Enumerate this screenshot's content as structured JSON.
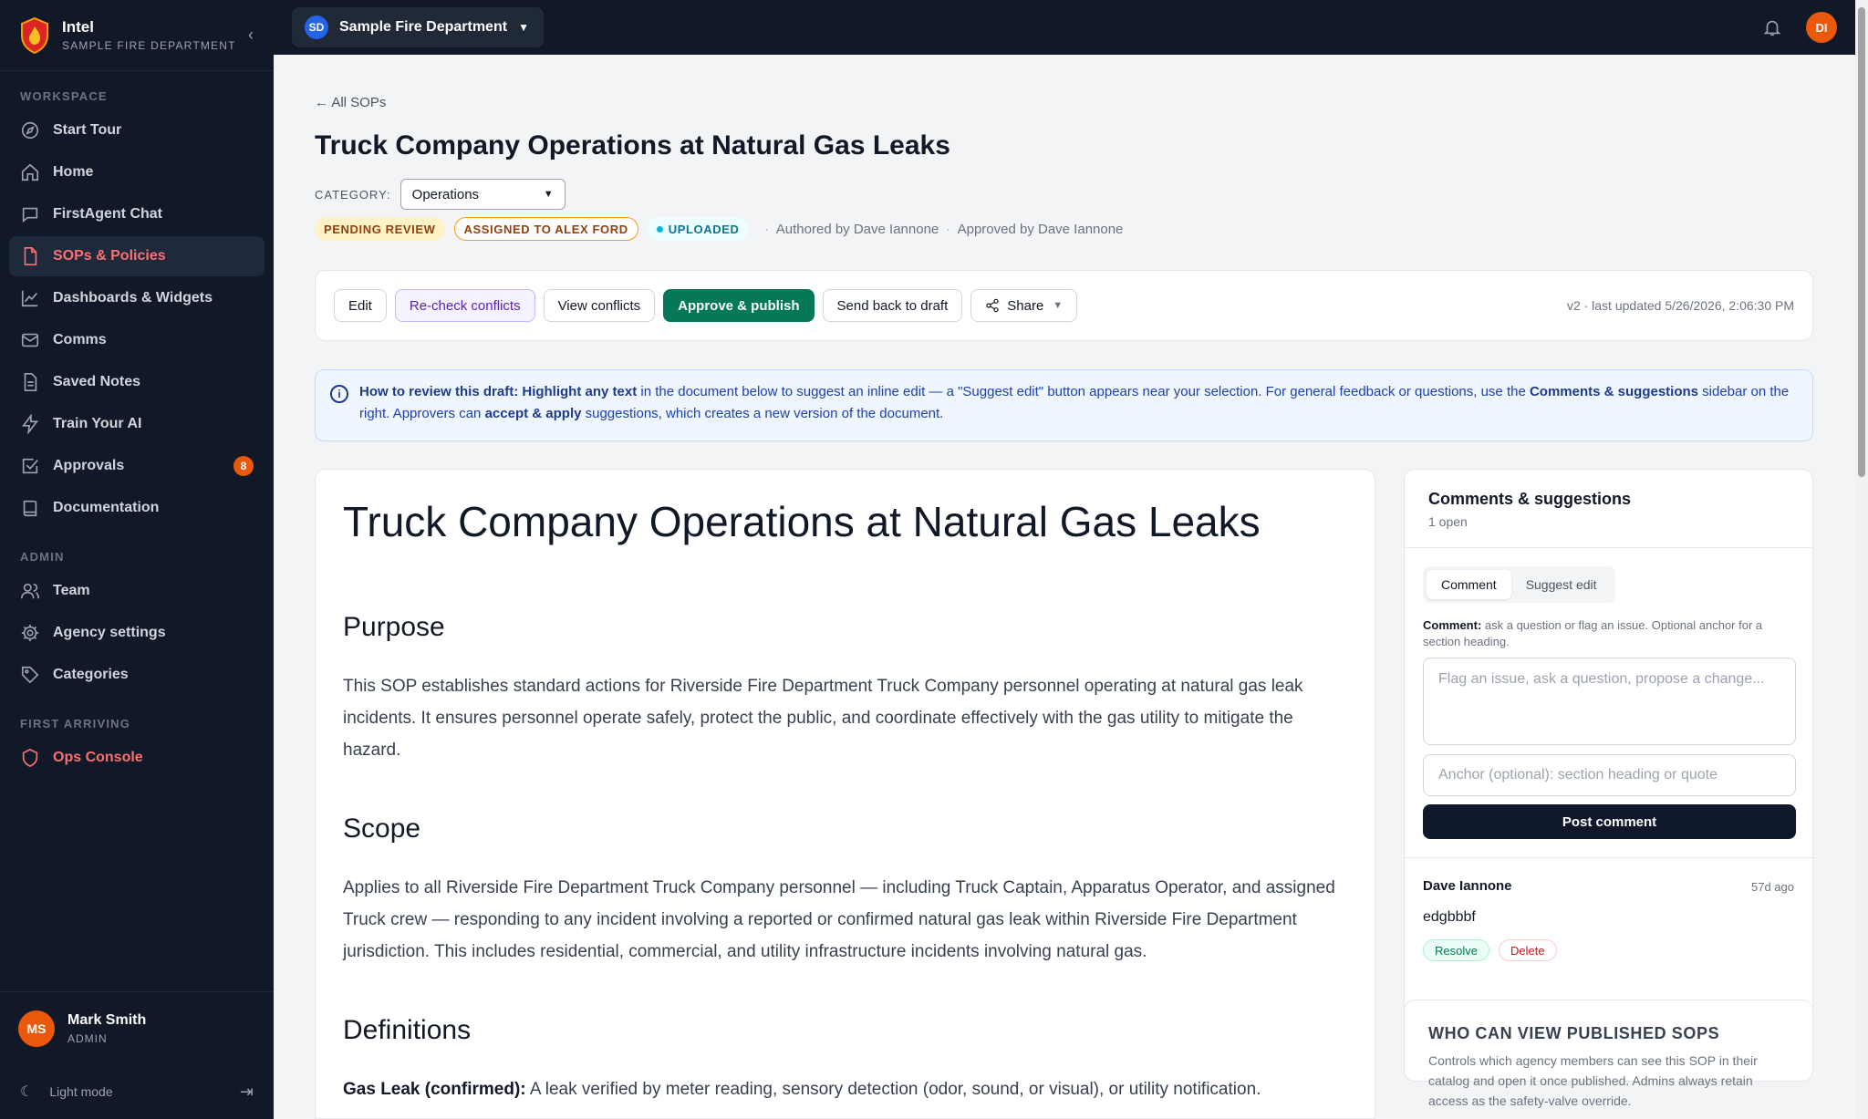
{
  "brand": {
    "name": "Intel",
    "subtitle": "SAMPLE FIRE DEPARTMENT"
  },
  "sidebar": {
    "workspace_label": "WORKSPACE",
    "workspace_items": [
      {
        "label": "Start Tour",
        "icon": "compass-icon"
      },
      {
        "label": "Home",
        "icon": "home-icon"
      },
      {
        "label": "FirstAgent Chat",
        "icon": "chat-icon"
      },
      {
        "label": "SOPs & Policies",
        "icon": "document-icon",
        "active": true
      },
      {
        "label": "Dashboards & Widgets",
        "icon": "chart-icon"
      },
      {
        "label": "Comms",
        "icon": "mail-icon"
      },
      {
        "label": "Saved Notes",
        "icon": "notes-icon"
      },
      {
        "label": "Train Your AI",
        "icon": "bolt-icon"
      },
      {
        "label": "Approvals",
        "icon": "check-square-icon",
        "badge": "8"
      },
      {
        "label": "Documentation",
        "icon": "book-icon"
      }
    ],
    "admin_label": "ADMIN",
    "admin_items": [
      {
        "label": "Team",
        "icon": "users-icon"
      },
      {
        "label": "Agency settings",
        "icon": "gear-icon"
      },
      {
        "label": "Categories",
        "icon": "tag-icon"
      }
    ],
    "first_arriving_label": "FIRST ARRIVING",
    "first_arriving_items": [
      {
        "label": "Ops Console",
        "icon": "shield-icon"
      }
    ],
    "user": {
      "initials": "MS",
      "name": "Mark Smith",
      "role": "ADMIN"
    },
    "mode_label": "Light mode"
  },
  "topbar": {
    "dept_initials": "SD",
    "dept_name": "Sample Fire Department",
    "user_initials": "DI"
  },
  "page": {
    "back_link": "← All SOPs",
    "title": "Truck Company Operations at Natural Gas Leaks",
    "category_label": "CATEGORY:",
    "category_value": "Operations",
    "badges": {
      "pending": "PENDING REVIEW",
      "assigned": "ASSIGNED TO ALEX FORD",
      "uploaded": "UPLOADED"
    },
    "authored_by": "Authored by Dave Iannone",
    "approved_by": "Approved by Dave Iannone",
    "sep": "·"
  },
  "toolbar": {
    "edit": "Edit",
    "recheck": "Re-check conflicts",
    "view_conflicts": "View conflicts",
    "approve": "Approve & publish",
    "send_back": "Send back to draft",
    "share": "Share",
    "version": "v2 · last updated 5/26/2026, 2:06:30 PM"
  },
  "info": {
    "lead": "How to review this draft:",
    "highlight": "Highlight any text",
    "t1": " in the document below to suggest an inline edit — a \"Suggest edit\" button appears near your selection. For general feedback or questions, use the ",
    "comments_link": "Comments & suggestions",
    "t2": " sidebar on the right. Approvers can ",
    "accept": "accept & apply",
    "t3": " suggestions, which creates a new version of the document."
  },
  "document": {
    "title": "Truck Company Operations at Natural Gas Leaks",
    "purpose_heading": "Purpose",
    "purpose_text": "This SOP establishes standard actions for Riverside Fire Department Truck Company personnel operating at natural gas leak incidents. It ensures personnel operate safely, protect the public, and coordinate effectively with the gas utility to mitigate the hazard.",
    "scope_heading": "Scope",
    "scope_text": "Applies to all Riverside Fire Department Truck Company personnel — including Truck Captain, Apparatus Operator, and assigned Truck crew — responding to any incident involving a reported or confirmed natural gas leak within Riverside Fire Department jurisdiction. This includes residential, commercial, and utility infrastructure incidents involving natural gas.",
    "definitions_heading": "Definitions",
    "def1_term": "Gas Leak (confirmed):",
    "def1_text": " A leak verified by meter reading, sensory detection (odor, sound, or visual), or utility notification."
  },
  "comments": {
    "title": "Comments & suggestions",
    "open_count": "1 open",
    "tab_comment": "Comment",
    "tab_suggest": "Suggest edit",
    "help_lead": "Comment:",
    "help_text": " ask a question or flag an issue. Optional anchor for a section heading.",
    "textarea_placeholder": "Flag an issue, ask a question, propose a change...",
    "anchor_placeholder": "Anchor (optional): section heading or quote",
    "post_label": "Post comment",
    "items": [
      {
        "author": "Dave Iannone",
        "time": "57d ago",
        "text": "edgbbbf",
        "resolve": "Resolve",
        "delete": "Delete"
      }
    ]
  },
  "viewers": {
    "title": "WHO CAN VIEW PUBLISHED SOPS",
    "text": "Controls which agency members can see this SOP in their catalog and open it once published. Admins always retain access as the safety-valve override."
  },
  "colors": {
    "accent": "#f87171",
    "primary_green": "#047857",
    "sidebar_bg": "#111827"
  }
}
